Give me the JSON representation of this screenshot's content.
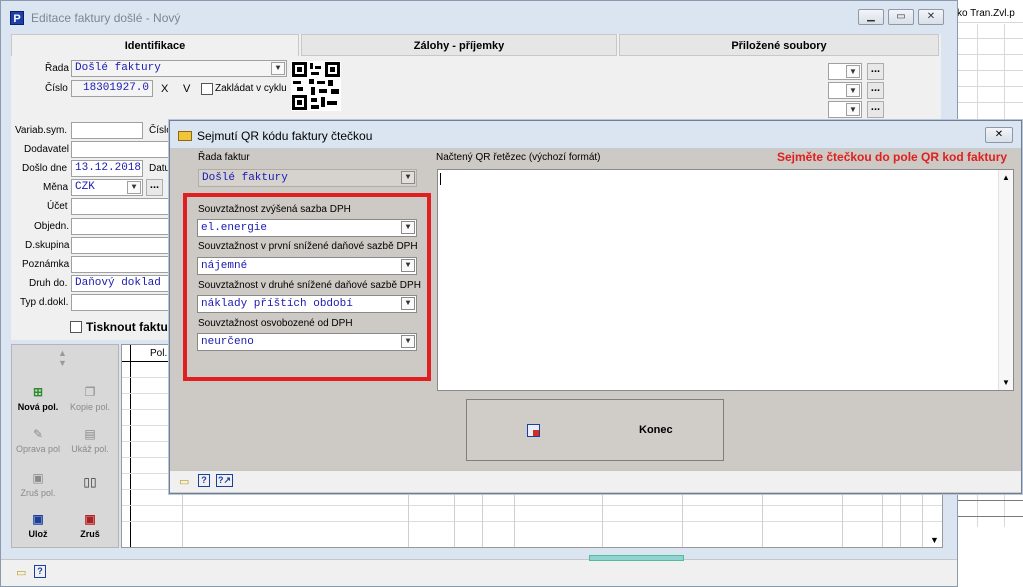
{
  "background_window": {
    "header": "sko Tran.Zvl.p"
  },
  "main_window": {
    "title": "Editace faktury došlé - Nový",
    "app_icon": "P",
    "tabs": [
      {
        "label": "Identifikace"
      },
      {
        "label": "Zálohy - příjemky"
      },
      {
        "label": "Přiložené soubory"
      }
    ],
    "fields": {
      "rada_label": "Řada",
      "rada_value": "Došlé faktury",
      "cislo_label": "Číslo",
      "cislo_value": "18301927.0",
      "cislo_x": "X",
      "cislo_v": "V",
      "zakladat_label": "Zakládat v cyklu",
      "variab_label": "Variab.sym.",
      "cislo2_label": "Číslo",
      "dodavatel_label": "Dodavatel",
      "doslo_label": "Došlo dne",
      "doslo_value": "13.12.2018",
      "datum_label": "Datu",
      "mena_label": "Měna",
      "mena_value": "CZK",
      "ucet_label": "Účet",
      "objedn_label": "Objedn.",
      "dskupina_label": "D.skupina",
      "poznamka_label": "Poznámka",
      "druh_label": "Druh do.",
      "druh_value": "Daňový doklad",
      "typ_label": "Typ d.dokl.",
      "tisknout_label": "Tisknout faktur"
    },
    "buttons": {
      "nova": "Nová pol.",
      "kopie": "Kopie pol.",
      "oprava": "Oprava pol",
      "ukaz": "Ukáž pol.",
      "zrus_pol": "Zruš pol.",
      "uloz": "Ulož",
      "zrus": "Zruš"
    },
    "grid": {
      "col_pol": "Pol."
    }
  },
  "dialog": {
    "title": "Sejmutí QR kódu faktury čtečkou",
    "rada_faktur_label": "Řada faktur",
    "rada_faktur_value": "Došlé faktury",
    "nacteny_label": "Načtený QR řetězec (výchozí formát)",
    "instruction": "Sejměte čtečkou do pole QR kod faktury",
    "souvz": [
      {
        "label": "Souvztažnost zvýšená sazba DPH",
        "value": "el.energie"
      },
      {
        "label": "Souvztažnost v první snížené daňové sazbě DPH",
        "value": "nájemné"
      },
      {
        "label": "Souvztažnost v druhé snížené daňové sazbě DPH",
        "value": "náklady příštích období"
      },
      {
        "label": "Souvztažnost osvobozené od DPH",
        "value": "neurčeno"
      }
    ],
    "konec_label": "Konec",
    "qr_text_value": ""
  },
  "icons": {
    "window_icon": "app-p-icon",
    "dialog_icon": "folder-icon",
    "konec_icon": "exit-icon"
  },
  "colors": {
    "instruction": "#e02020",
    "highlight_box": "#e02020",
    "field_text": "#1a1ab0"
  }
}
